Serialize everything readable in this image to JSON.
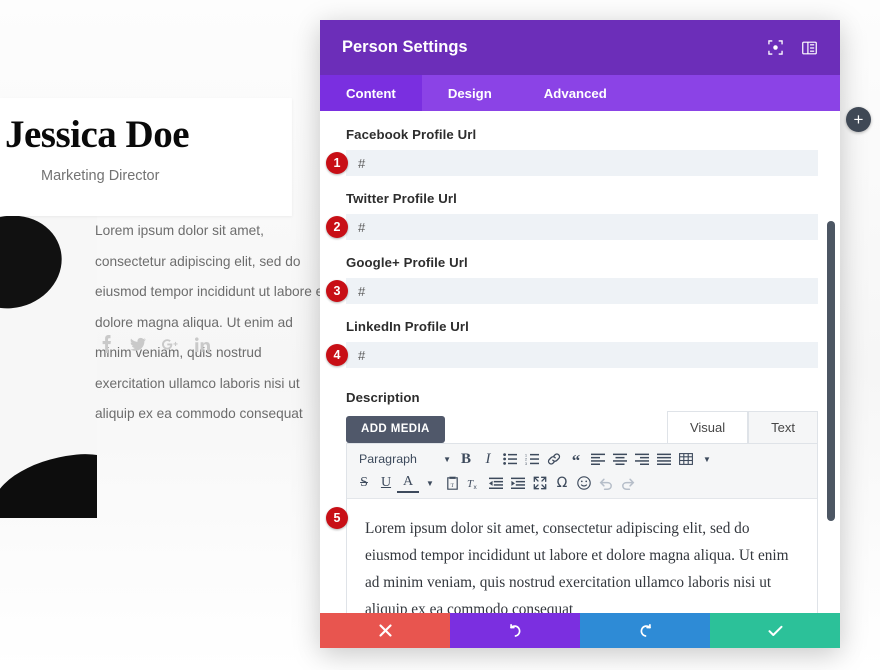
{
  "preview": {
    "name": "Jessica Doe",
    "role": "Marketing Director",
    "body": "Lorem ipsum dolor sit amet, consectetur adipiscing elit, sed do eiusmod tempor incididunt ut labore et dolore magna aliqua. Ut enim ad minim veniam, quis nostrud exercitation ullamco laboris nisi ut aliquip ex ea commodo consequat",
    "social": [
      {
        "name": "facebook-icon"
      },
      {
        "name": "twitter-icon"
      },
      {
        "name": "google-plus-icon"
      },
      {
        "name": "linkedin-icon"
      }
    ]
  },
  "modal": {
    "title": "Person Settings",
    "header_icons": [
      {
        "name": "focus-mode-icon"
      },
      {
        "name": "split-view-icon"
      }
    ],
    "tabs": [
      {
        "label": "Content",
        "active": true
      },
      {
        "label": "Design",
        "active": false
      },
      {
        "label": "Advanced",
        "active": false
      }
    ],
    "fields": [
      {
        "badge": "1",
        "label": "Facebook Profile Url",
        "value": "#"
      },
      {
        "badge": "2",
        "label": "Twitter Profile Url",
        "value": "#"
      },
      {
        "badge": "3",
        "label": "Google+ Profile Url",
        "value": "#"
      },
      {
        "badge": "4",
        "label": "LinkedIn Profile Url",
        "value": "#"
      }
    ],
    "description": {
      "badge": "5",
      "label": "Description",
      "add_media_label": "ADD MEDIA",
      "editor_tabs": [
        {
          "label": "Visual",
          "active": true
        },
        {
          "label": "Text",
          "active": false
        }
      ],
      "format_select": "Paragraph",
      "toolbar_row1": [
        "bold-icon",
        "italic-icon",
        "bulleted-list-icon",
        "numbered-list-icon",
        "link-icon",
        "blockquote-icon",
        "align-left-icon",
        "align-center-icon",
        "align-right-icon",
        "align-justify-icon",
        "table-icon"
      ],
      "toolbar_row2": [
        "strikethrough-icon",
        "underline-icon",
        "text-color-icon",
        "paste-as-text-icon",
        "clear-formatting-icon",
        "outdent-icon",
        "indent-icon",
        "fullscreen-icon",
        "special-character-icon",
        "emoji-icon",
        "undo-icon",
        "redo-icon"
      ],
      "content": "Lorem ipsum dolor sit amet, consectetur adipiscing elit, sed do eiusmod tempor incididunt ut labore et dolore magna aliqua. Ut enim ad minim veniam, quis nostrud exercitation ullamco laboris nisi ut aliquip ex ea commodo consequat"
    },
    "footer": [
      {
        "name": "cancel-button",
        "icon": "close-icon",
        "color": "#e8554f"
      },
      {
        "name": "undo-button",
        "icon": "undo-icon",
        "color": "#7b2fe0"
      },
      {
        "name": "redo-button",
        "icon": "redo-icon",
        "color": "#2e8bd6"
      },
      {
        "name": "save-button",
        "icon": "check-icon",
        "color": "#2cc199"
      }
    ]
  },
  "fab": {
    "label": "+"
  },
  "colors": {
    "header_purple": "#6c2eb9",
    "tab_purple": "#8b43e6",
    "tab_active": "#7a2fe0",
    "badge_red": "#c80f16"
  }
}
